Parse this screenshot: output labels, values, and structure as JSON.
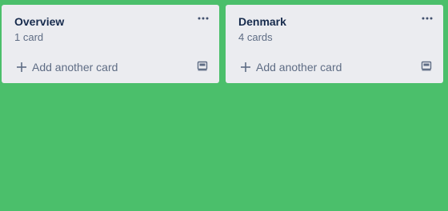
{
  "board": {
    "background_color": "#4bbf6b",
    "lists": [
      {
        "title": "Overview",
        "card_count": "1 card",
        "menu_icon": "more-horizontal-icon",
        "add_card_icon": "plus-icon",
        "add_card_label": "Add another card",
        "template_icon": "card-template-icon"
      },
      {
        "title": "Denmark",
        "card_count": "4 cards",
        "menu_icon": "more-horizontal-icon",
        "add_card_icon": "plus-icon",
        "add_card_label": "Add another card",
        "template_icon": "card-template-icon"
      }
    ]
  },
  "colors": {
    "list_background": "#ebecf0",
    "title_text": "#172b4d",
    "secondary_text": "#5e6c84"
  }
}
